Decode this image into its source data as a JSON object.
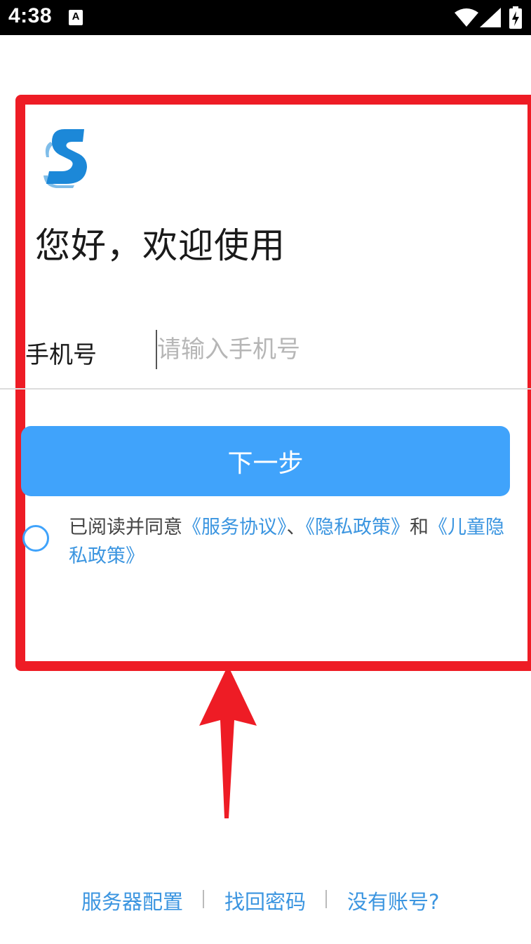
{
  "status_bar": {
    "time": "4:38",
    "notification_icon": "A",
    "icons": [
      "wifi-icon",
      "signal-icon",
      "battery-charging-icon"
    ]
  },
  "login": {
    "title": "您好，欢迎使用",
    "phone_label": "手机号",
    "phone_placeholder": "请输入手机号",
    "phone_value": "",
    "next_button": "下一步",
    "agreement": {
      "prefix": "已阅读并同意",
      "service_link": "《服务协议》",
      "sep1": "、",
      "privacy_link": "《隐私政策》",
      "sep2": "和",
      "child_privacy_link": "《儿童隐私政策》"
    }
  },
  "footer": {
    "server_config": "服务器配置",
    "forgot_password": "找回密码",
    "no_account": "没有账号?"
  },
  "colors": {
    "accent": "#40a3fb",
    "link": "#3b95e0",
    "highlight": "#ee1c25"
  }
}
